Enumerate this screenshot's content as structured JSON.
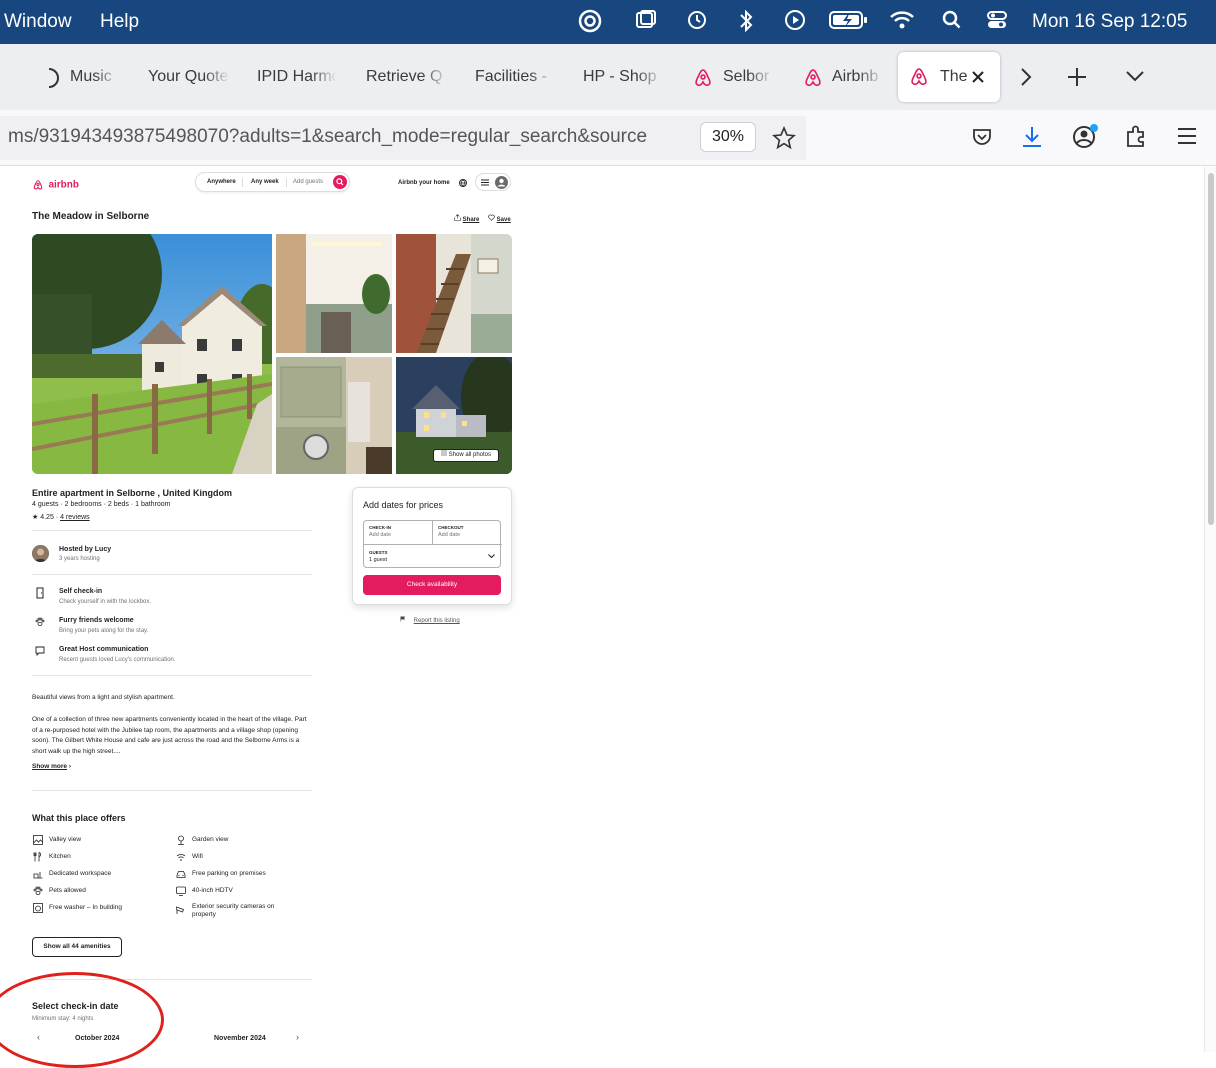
{
  "menubar": {
    "window_label": "Window",
    "help_label": "Help",
    "datetime": "Mon 16 Sep  12:05"
  },
  "tabs": [
    {
      "label": "Music"
    },
    {
      "label": "Your Quote"
    },
    {
      "label": "IPID Harmo"
    },
    {
      "label": "Retrieve Q"
    },
    {
      "label": "Facilities -"
    },
    {
      "label": "HP - Shop"
    },
    {
      "label": "Selbor"
    },
    {
      "label": "Airbnb"
    },
    {
      "label": "The"
    }
  ],
  "navbar": {
    "url": "ms/931943493875498070?adults=1&search_mode=regular_search&source",
    "zoom": "30%"
  },
  "airbnb": {
    "logo": "airbnb",
    "search": {
      "anywhere": "Anywhere",
      "anyweek": "Any week",
      "guests": "Add guests"
    },
    "host_link": "Airbnb your home",
    "title": "The Meadow in Selborne",
    "share": "Share",
    "save": "Save",
    "show_all_photos": "Show all photos",
    "subtitle": "Entire apartment in Selborne , United Kingdom",
    "details": "4 guests · 2 bedrooms · 2 beds · 1 bathroom",
    "rating": "★ 4.25 ·",
    "reviews": "4 reviews",
    "host_name": "Hosted by Lucy",
    "host_years": "3 years hosting",
    "highlights": [
      {
        "title": "Self check-in",
        "desc": "Check yourself in with the lockbox."
      },
      {
        "title": "Furry friends welcome",
        "desc": "Bring your pets along for the stay."
      },
      {
        "title": "Great Host communication",
        "desc": "Recent guests loved Lucy's communication."
      }
    ],
    "desc1": "Beautiful views from a light and stylish apartment.",
    "desc2": "One of a collection of three new apartments conveniently located in the heart of the village. Part of a re-purposed hotel with the Jubilee tap room, the apartments and a village shop (opening soon). The Gilbert White House and cafe are just across the road and the Selborne Arms is a short walk up the high street....",
    "show_more": "Show more",
    "offers_title": "What this place offers",
    "amenities_left": [
      "Valley view",
      "Kitchen",
      "Dedicated workspace",
      "Pets allowed",
      "Free washer – In building"
    ],
    "amenities_right": [
      "Garden view",
      "Wifi",
      "Free parking on premises",
      "40-inch HDTV",
      "Exterior security cameras on property"
    ],
    "show_amenities": "Show all 44 amenities",
    "checkin_title": "Select check-in date",
    "min_stay": "Minimum stay: 4 nights",
    "month1": "October 2024",
    "month2": "November 2024",
    "booking": {
      "title": "Add dates for prices",
      "checkin_label": "CHECK-IN",
      "checkin_value": "Add date",
      "checkout_label": "CHECKOUT",
      "checkout_value": "Add date",
      "guests_label": "GUESTS",
      "guests_value": "1 guest",
      "button": "Check availability",
      "report": "Report this listing"
    },
    "brand_color": "#e31c5f"
  }
}
